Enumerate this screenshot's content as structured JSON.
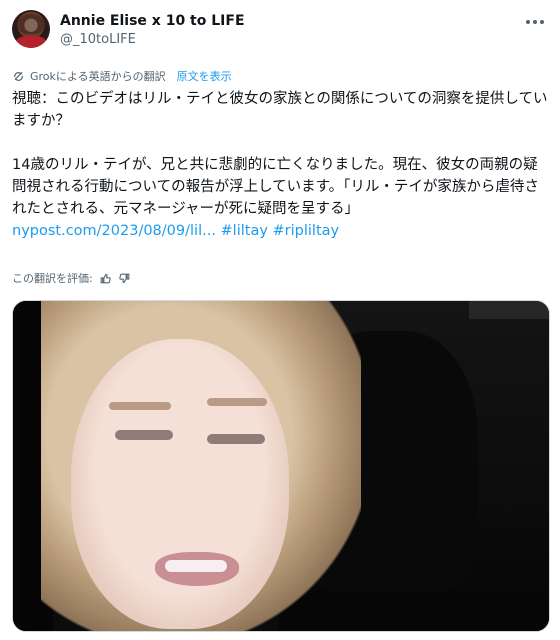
{
  "post": {
    "author": {
      "display_name": "Annie Elise x 10 to LIFE",
      "handle": "@_10toLIFE"
    },
    "translation_notice": "Grokによる英語からの翻訳",
    "show_original_label": "原文を表示",
    "text": {
      "line1": "視聴：このビデオはリル・テイと彼女の家族との関係についての洞察を提供していますか？",
      "para2": "14歳のリル・テイが、兄と共に悲劇的に亡くなりました。現在、彼女の両親の疑問視される行動についての報告が浮上しています。「リル・テイが家族から虐待されたとされる、元マネージャーが死に疑問を呈する」",
      "link": "nypost.com/2023/08/09/lil...",
      "hashtag1": "#liltay",
      "hashtag2": "#ripliltay"
    },
    "rate_translation_label": "この翻訳を評価:"
  },
  "icons": {
    "more": "more-horizontal-icon",
    "translate": "grok-icon",
    "thumbs_up": "thumbs-up-icon",
    "thumbs_down": "thumbs-down-icon"
  },
  "colors": {
    "accent": "#1d9bf0",
    "text": "#0f1419",
    "secondary": "#536471"
  }
}
